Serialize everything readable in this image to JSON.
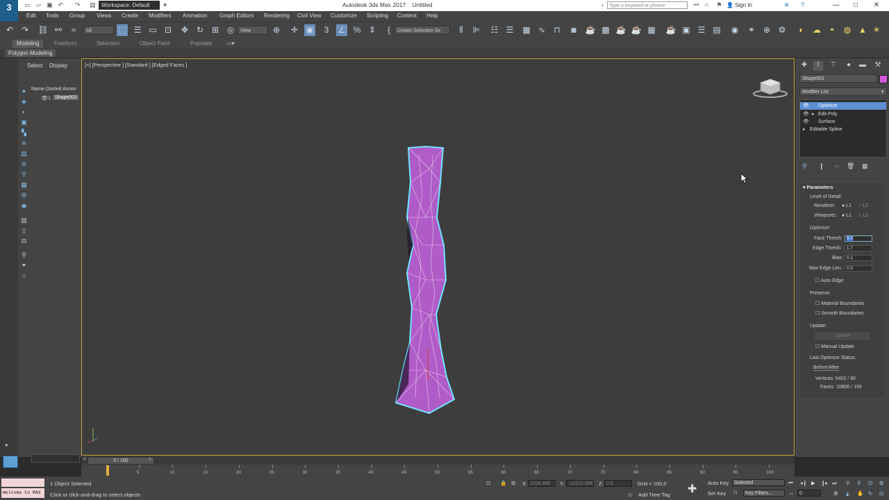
{
  "window": {
    "app_logo": "3",
    "app_logo_sub": "MAX",
    "workspace": "Workspace: Default",
    "title": "Autodesk 3ds Max 2017",
    "doc_name": "Untitled",
    "search_placeholder": "Type a keyword or phrase",
    "sign_in": "Sign In",
    "controls": [
      "—",
      "□",
      "✕"
    ]
  },
  "menu": [
    "Edit",
    "Tools",
    "Group",
    "Views",
    "Create",
    "Modifiers",
    "Animation",
    "Graph Editors",
    "Rendering",
    "Civil View",
    "Customize",
    "Scripting",
    "Content",
    "Help"
  ],
  "toolbar": {
    "selection_filter": "All",
    "ref_coord": "View",
    "named_selection": "Create Selection Se"
  },
  "ribbon": {
    "tabs": [
      "Modeling",
      "Freeform",
      "Selection",
      "Object Paint",
      "Populate"
    ],
    "active_tab": "Modeling",
    "panel": "Polygon Modeling"
  },
  "scene_explorer": {
    "tabs": [
      "Select",
      "Display"
    ],
    "column": "Name (Sorted Ascen",
    "items": [
      "Shape001"
    ]
  },
  "viewport": {
    "label": "[+] [Perspective ] [Standard ] [Edged Faces ]",
    "object_color": "#b05cc8",
    "wire_color": "#6fe6ff"
  },
  "command_panel": {
    "object_name": "Shape001",
    "object_color": "#d05ad8",
    "modifier_list": "Modifier List",
    "stack": [
      {
        "name": "Optimize",
        "selected": true
      },
      {
        "name": "Edit Poly",
        "selected": false
      },
      {
        "name": "Surface",
        "selected": false
      },
      {
        "name": "Editable Spline",
        "selected": false
      }
    ],
    "params": {
      "title": "Parameters",
      "lod": "Level of Detail:",
      "renderer": "Renderer:",
      "viewports": "Viewports:",
      "l1": "L1",
      "l2": "L2",
      "optimize": "Optimize:",
      "face_thresh_label": "Face Thresh:",
      "face_thresh": "8.0",
      "edge_thresh_label": "Edge Thresh:",
      "edge_thresh": "1.7",
      "bias_label": "Bias:",
      "bias": "0.1",
      "max_edge_label": "Max Edge Len:",
      "max_edge": "0.0",
      "auto_edge": "Auto Edge",
      "preserve": "Preserve:",
      "material_boundaries": "Material Boundaries",
      "smooth_boundaries": "Smooth Boundaries",
      "update_section": "Update:",
      "update_button": "Update",
      "manual_update": "Manual Update",
      "last_status": "Last Optimize Status:",
      "before_after": "Before/After",
      "vertices": "Vertices: 5402 / 80",
      "faces": "Faces: 10800 / 156"
    }
  },
  "timeline": {
    "slider": "0 / 100",
    "ticks": [
      "0",
      "5",
      "10",
      "15",
      "20",
      "25",
      "30",
      "35",
      "40",
      "45",
      "50",
      "55",
      "60",
      "65",
      "70",
      "75",
      "80",
      "85",
      "90",
      "95",
      "100"
    ]
  },
  "status": {
    "maxscript": "Welcome to MAX",
    "selected": "1 Object Selected",
    "prompt": "Click or click-and-drag to select objects",
    "x_label": "X:",
    "x_value": "2156.966",
    "y_label": "Y:",
    "y_value": "-12212.308",
    "z_label": "Z:",
    "z_value": "0.0",
    "grid": "Grid = 100.0",
    "add_time_tag": "Add Time Tag",
    "auto_key": "Auto Key",
    "set_key": "Set Key",
    "selected_dd": "Selected",
    "key_filters": "Key Filters...",
    "frame": "0"
  }
}
